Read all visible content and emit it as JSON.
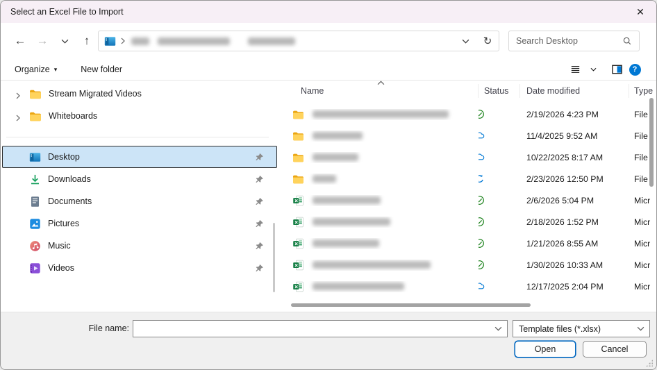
{
  "window": {
    "title": "Select an Excel File to Import",
    "close_glyph": "✕"
  },
  "nav": {
    "address": {
      "redacted_segments": [
        26,
        104,
        68
      ]
    },
    "search_placeholder": "Search Desktop"
  },
  "toolbar": {
    "organize_label": "Organize",
    "new_folder_label": "New folder",
    "caret_glyph": "▾"
  },
  "sidebar": {
    "tree_items": [
      {
        "label": "Stream Migrated Videos",
        "icon": "folder-icon"
      },
      {
        "label": "Whiteboards",
        "icon": "folder-icon"
      }
    ],
    "quick_items": [
      {
        "label": "Desktop",
        "icon": "desktop-icon",
        "selected": true,
        "pinned": true
      },
      {
        "label": "Downloads",
        "icon": "downloads-icon",
        "selected": false,
        "pinned": true
      },
      {
        "label": "Documents",
        "icon": "documents-icon",
        "selected": false,
        "pinned": true
      },
      {
        "label": "Pictures",
        "icon": "pictures-icon",
        "selected": false,
        "pinned": true
      },
      {
        "label": "Music",
        "icon": "music-icon",
        "selected": false,
        "pinned": true
      },
      {
        "label": "Videos",
        "icon": "videos-icon",
        "selected": false,
        "pinned": true
      }
    ]
  },
  "file_list": {
    "columns": {
      "name": "Name",
      "status": "Status",
      "date": "Date modified",
      "type": "Type"
    },
    "rows": [
      {
        "kind": "folder",
        "status": "synced",
        "date": "2/19/2026 4:23 PM",
        "type": "File f",
        "name_redacted_width": 196
      },
      {
        "kind": "folder",
        "status": "cloud",
        "date": "11/4/2025 9:52 AM",
        "type": "File f",
        "name_redacted_width": 72
      },
      {
        "kind": "folder",
        "status": "cloud",
        "date": "10/22/2025 8:17 AM",
        "type": "File f",
        "name_redacted_width": 66
      },
      {
        "kind": "folder",
        "status": "syncing",
        "date": "2/23/2026 12:50 PM",
        "type": "File f",
        "name_redacted_width": 34
      },
      {
        "kind": "excel",
        "status": "synced",
        "date": "2/6/2026 5:04 PM",
        "type": "Micr",
        "name_redacted_width": 98
      },
      {
        "kind": "excel",
        "status": "synced",
        "date": "2/18/2026 1:52 PM",
        "type": "Micr",
        "name_redacted_width": 112
      },
      {
        "kind": "excel",
        "status": "synced",
        "date": "1/21/2026 8:55 AM",
        "type": "Micr",
        "name_redacted_width": 96
      },
      {
        "kind": "excel",
        "status": "synced",
        "date": "1/30/2026 10:33 AM",
        "type": "Micr",
        "name_redacted_width": 170
      },
      {
        "kind": "excel",
        "status": "cloud",
        "date": "12/17/2025 2:04 PM",
        "type": "Micr",
        "name_redacted_width": 132
      }
    ]
  },
  "footer": {
    "file_name_label": "File name:",
    "file_name_value": "",
    "file_type_value": "Template files (*.xlsx)",
    "open_label": "Open",
    "cancel_label": "Cancel"
  },
  "colors": {
    "accent_blue": "#0067c0",
    "status_green": "#0f7b0f",
    "status_blue": "#0078d4",
    "titlebar": "#f7eff6",
    "selection": "#cce4f7"
  }
}
